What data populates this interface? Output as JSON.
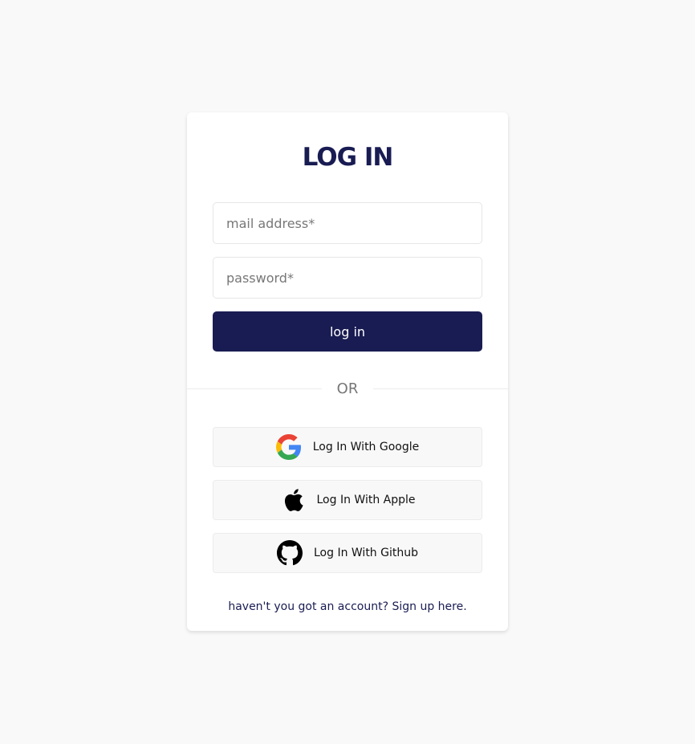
{
  "login": {
    "title": "LOG IN",
    "email_placeholder": "mail address*",
    "password_placeholder": "password*",
    "submit_label": "log in",
    "divider_label": "OR"
  },
  "social": {
    "google_label": "Log In With Google",
    "apple_label": "Log In With Apple",
    "github_label": "Log In With Github"
  },
  "footer": {
    "prompt": "haven't you got an account?",
    "signup_link": "Sign up here."
  },
  "colors": {
    "primary": "#191c52",
    "background": "#f9f9f9",
    "card": "#ffffff"
  },
  "icons": {
    "google": "google-icon",
    "apple": "apple-icon",
    "github": "github-icon"
  }
}
